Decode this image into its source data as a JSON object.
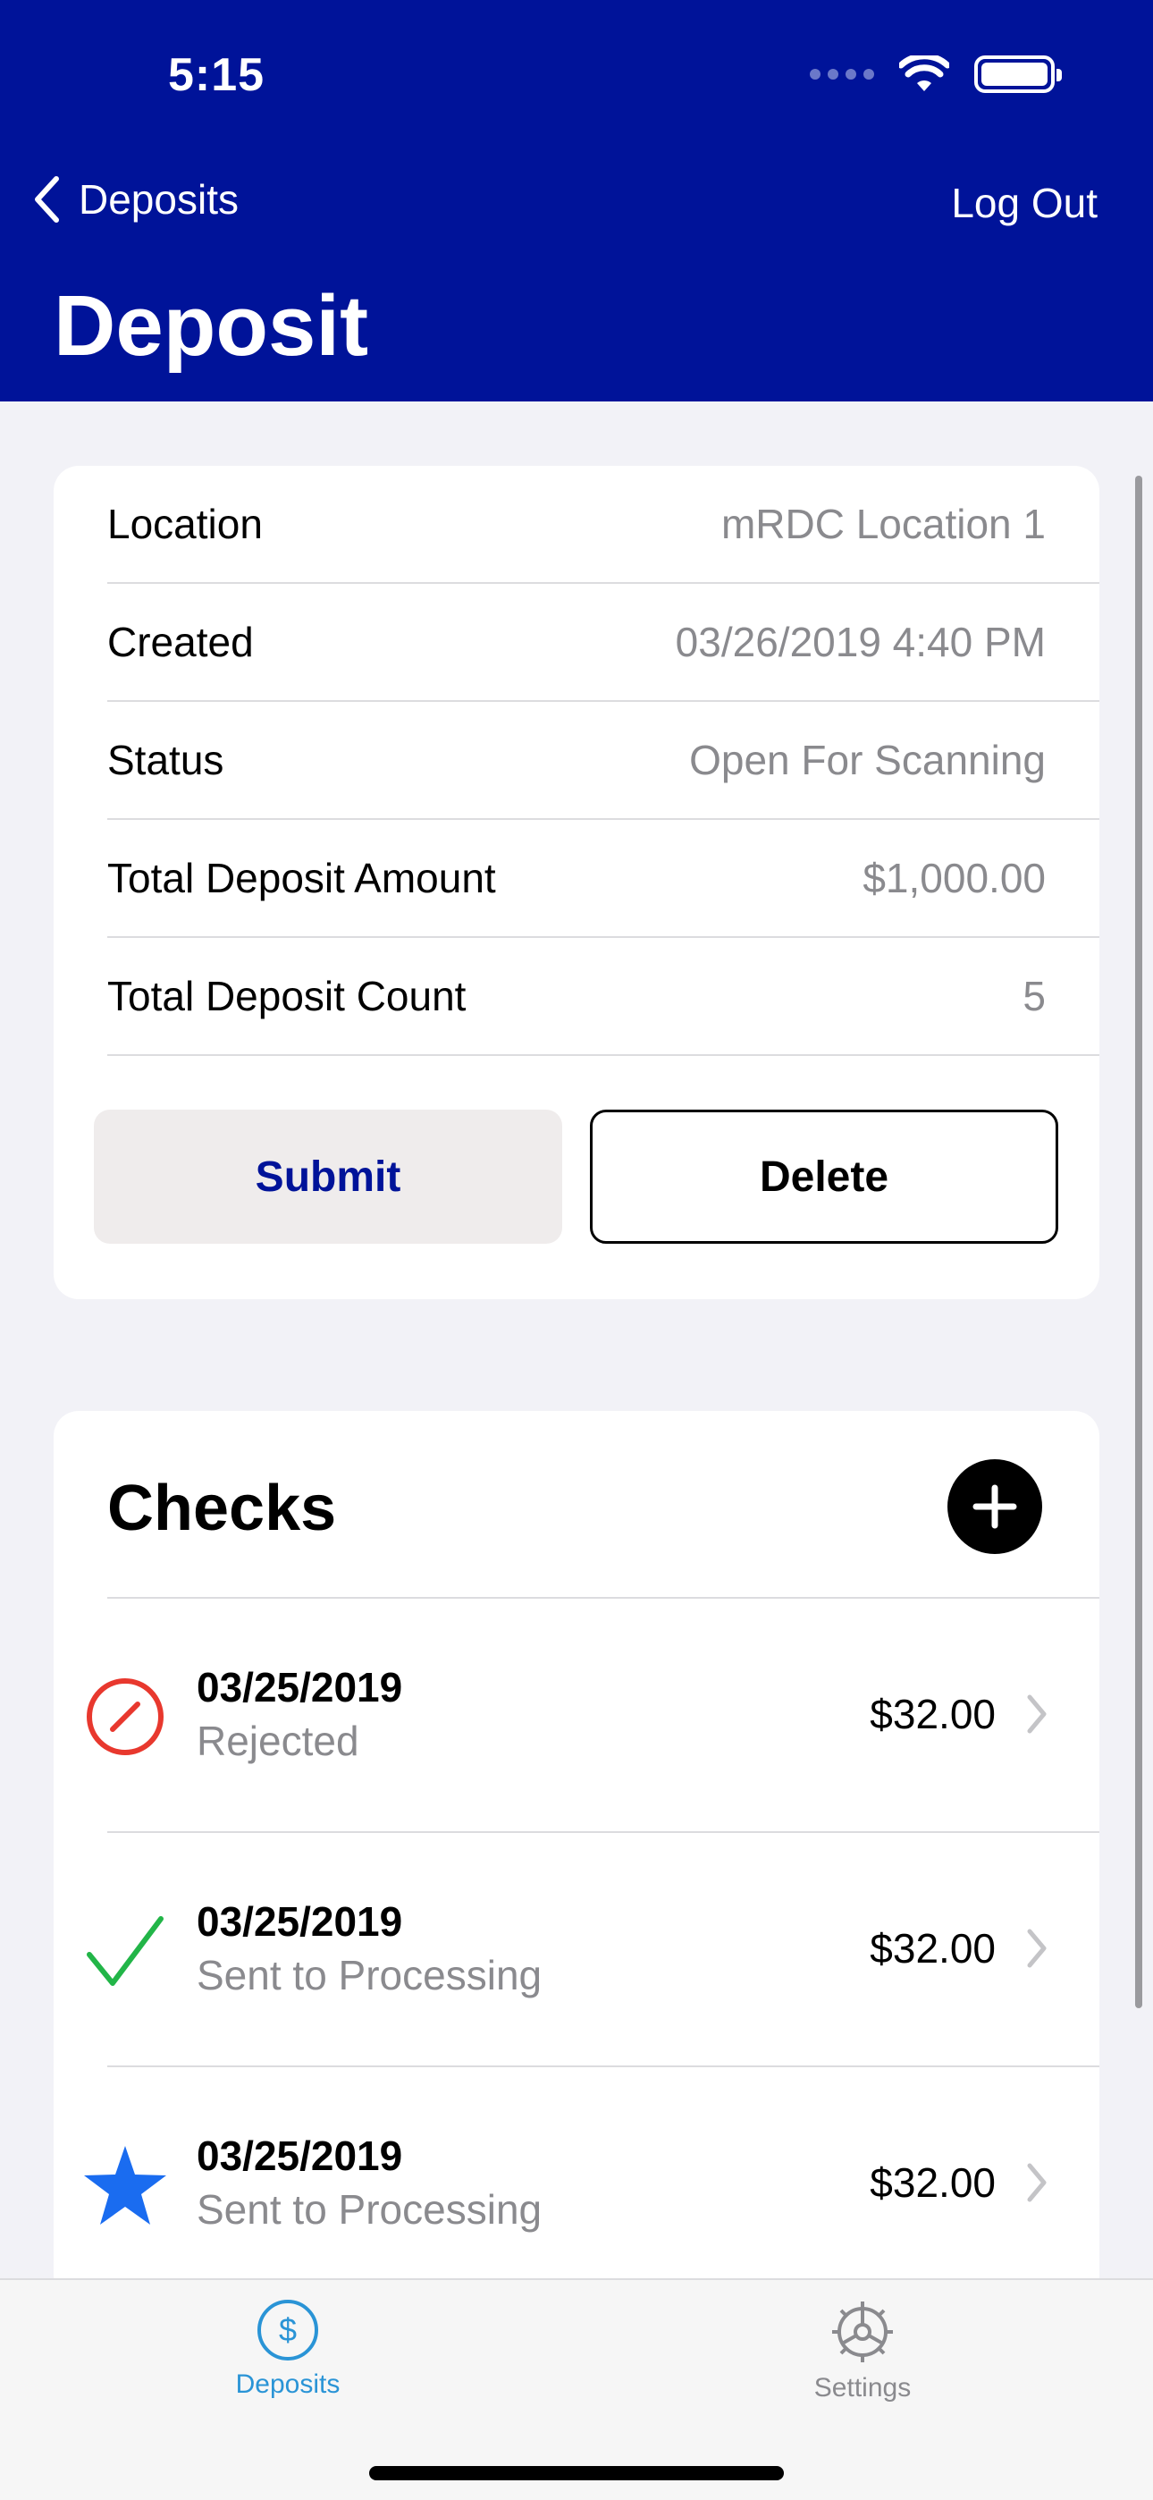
{
  "status_bar": {
    "time": "5:15"
  },
  "nav": {
    "back_label": "Deposits",
    "logout_label": "Log Out",
    "title": "Deposit"
  },
  "deposit_info": {
    "rows": [
      {
        "label": "Location",
        "value": "mRDC Location 1"
      },
      {
        "label": "Created",
        "value": "03/26/2019 4:40 PM"
      },
      {
        "label": "Status",
        "value": "Open For Scanning"
      },
      {
        "label": "Total Deposit Amount",
        "value": "$1,000.00"
      },
      {
        "label": "Total Deposit Count",
        "value": "5"
      }
    ],
    "submit_label": "Submit",
    "delete_label": "Delete"
  },
  "checks": {
    "title": "Checks",
    "items": [
      {
        "date": "03/25/2019",
        "status": "Rejected",
        "amount": "$32.00",
        "icon": "rejected-icon"
      },
      {
        "date": "03/25/2019",
        "status": "Sent to Processing",
        "amount": "$32.00",
        "icon": "checkmark-icon"
      },
      {
        "date": "03/25/2019",
        "status": "Sent to Processing",
        "amount": "$32.00",
        "icon": "star-icon"
      }
    ]
  },
  "tabbar": {
    "tabs": [
      {
        "label": "Deposits",
        "icon": "dollar-circle-icon",
        "active": true
      },
      {
        "label": "Settings",
        "icon": "gear-icon",
        "active": false
      }
    ]
  },
  "colors": {
    "brand": "#001399",
    "accent": "#2a94d6",
    "rejected": "#e8382e",
    "accepted": "#22b548",
    "star": "#1a6cf0"
  }
}
